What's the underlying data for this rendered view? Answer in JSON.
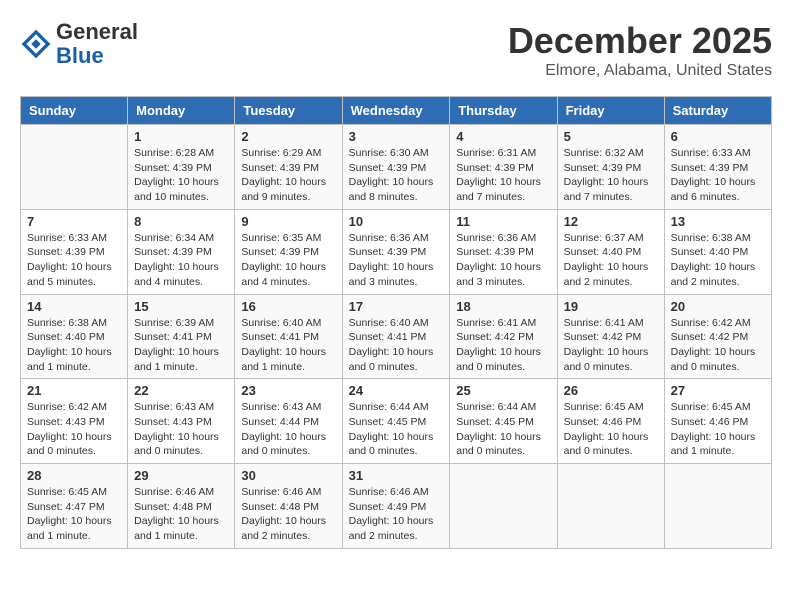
{
  "header": {
    "logo_general": "General",
    "logo_blue": "Blue",
    "month_title": "December 2025",
    "location": "Elmore, Alabama, United States"
  },
  "days_of_week": [
    "Sunday",
    "Monday",
    "Tuesday",
    "Wednesday",
    "Thursday",
    "Friday",
    "Saturday"
  ],
  "weeks": [
    [
      {
        "day": "",
        "info": ""
      },
      {
        "day": "1",
        "info": "Sunrise: 6:28 AM\nSunset: 4:39 PM\nDaylight: 10 hours\nand 10 minutes."
      },
      {
        "day": "2",
        "info": "Sunrise: 6:29 AM\nSunset: 4:39 PM\nDaylight: 10 hours\nand 9 minutes."
      },
      {
        "day": "3",
        "info": "Sunrise: 6:30 AM\nSunset: 4:39 PM\nDaylight: 10 hours\nand 8 minutes."
      },
      {
        "day": "4",
        "info": "Sunrise: 6:31 AM\nSunset: 4:39 PM\nDaylight: 10 hours\nand 7 minutes."
      },
      {
        "day": "5",
        "info": "Sunrise: 6:32 AM\nSunset: 4:39 PM\nDaylight: 10 hours\nand 7 minutes."
      },
      {
        "day": "6",
        "info": "Sunrise: 6:33 AM\nSunset: 4:39 PM\nDaylight: 10 hours\nand 6 minutes."
      }
    ],
    [
      {
        "day": "7",
        "info": "Sunrise: 6:33 AM\nSunset: 4:39 PM\nDaylight: 10 hours\nand 5 minutes."
      },
      {
        "day": "8",
        "info": "Sunrise: 6:34 AM\nSunset: 4:39 PM\nDaylight: 10 hours\nand 4 minutes."
      },
      {
        "day": "9",
        "info": "Sunrise: 6:35 AM\nSunset: 4:39 PM\nDaylight: 10 hours\nand 4 minutes."
      },
      {
        "day": "10",
        "info": "Sunrise: 6:36 AM\nSunset: 4:39 PM\nDaylight: 10 hours\nand 3 minutes."
      },
      {
        "day": "11",
        "info": "Sunrise: 6:36 AM\nSunset: 4:39 PM\nDaylight: 10 hours\nand 3 minutes."
      },
      {
        "day": "12",
        "info": "Sunrise: 6:37 AM\nSunset: 4:40 PM\nDaylight: 10 hours\nand 2 minutes."
      },
      {
        "day": "13",
        "info": "Sunrise: 6:38 AM\nSunset: 4:40 PM\nDaylight: 10 hours\nand 2 minutes."
      }
    ],
    [
      {
        "day": "14",
        "info": "Sunrise: 6:38 AM\nSunset: 4:40 PM\nDaylight: 10 hours\nand 1 minute."
      },
      {
        "day": "15",
        "info": "Sunrise: 6:39 AM\nSunset: 4:41 PM\nDaylight: 10 hours\nand 1 minute."
      },
      {
        "day": "16",
        "info": "Sunrise: 6:40 AM\nSunset: 4:41 PM\nDaylight: 10 hours\nand 1 minute."
      },
      {
        "day": "17",
        "info": "Sunrise: 6:40 AM\nSunset: 4:41 PM\nDaylight: 10 hours\nand 0 minutes."
      },
      {
        "day": "18",
        "info": "Sunrise: 6:41 AM\nSunset: 4:42 PM\nDaylight: 10 hours\nand 0 minutes."
      },
      {
        "day": "19",
        "info": "Sunrise: 6:41 AM\nSunset: 4:42 PM\nDaylight: 10 hours\nand 0 minutes."
      },
      {
        "day": "20",
        "info": "Sunrise: 6:42 AM\nSunset: 4:42 PM\nDaylight: 10 hours\nand 0 minutes."
      }
    ],
    [
      {
        "day": "21",
        "info": "Sunrise: 6:42 AM\nSunset: 4:43 PM\nDaylight: 10 hours\nand 0 minutes."
      },
      {
        "day": "22",
        "info": "Sunrise: 6:43 AM\nSunset: 4:43 PM\nDaylight: 10 hours\nand 0 minutes."
      },
      {
        "day": "23",
        "info": "Sunrise: 6:43 AM\nSunset: 4:44 PM\nDaylight: 10 hours\nand 0 minutes."
      },
      {
        "day": "24",
        "info": "Sunrise: 6:44 AM\nSunset: 4:45 PM\nDaylight: 10 hours\nand 0 minutes."
      },
      {
        "day": "25",
        "info": "Sunrise: 6:44 AM\nSunset: 4:45 PM\nDaylight: 10 hours\nand 0 minutes."
      },
      {
        "day": "26",
        "info": "Sunrise: 6:45 AM\nSunset: 4:46 PM\nDaylight: 10 hours\nand 0 minutes."
      },
      {
        "day": "27",
        "info": "Sunrise: 6:45 AM\nSunset: 4:46 PM\nDaylight: 10 hours\nand 1 minute."
      }
    ],
    [
      {
        "day": "28",
        "info": "Sunrise: 6:45 AM\nSunset: 4:47 PM\nDaylight: 10 hours\nand 1 minute."
      },
      {
        "day": "29",
        "info": "Sunrise: 6:46 AM\nSunset: 4:48 PM\nDaylight: 10 hours\nand 1 minute."
      },
      {
        "day": "30",
        "info": "Sunrise: 6:46 AM\nSunset: 4:48 PM\nDaylight: 10 hours\nand 2 minutes."
      },
      {
        "day": "31",
        "info": "Sunrise: 6:46 AM\nSunset: 4:49 PM\nDaylight: 10 hours\nand 2 minutes."
      },
      {
        "day": "",
        "info": ""
      },
      {
        "day": "",
        "info": ""
      },
      {
        "day": "",
        "info": ""
      }
    ]
  ]
}
